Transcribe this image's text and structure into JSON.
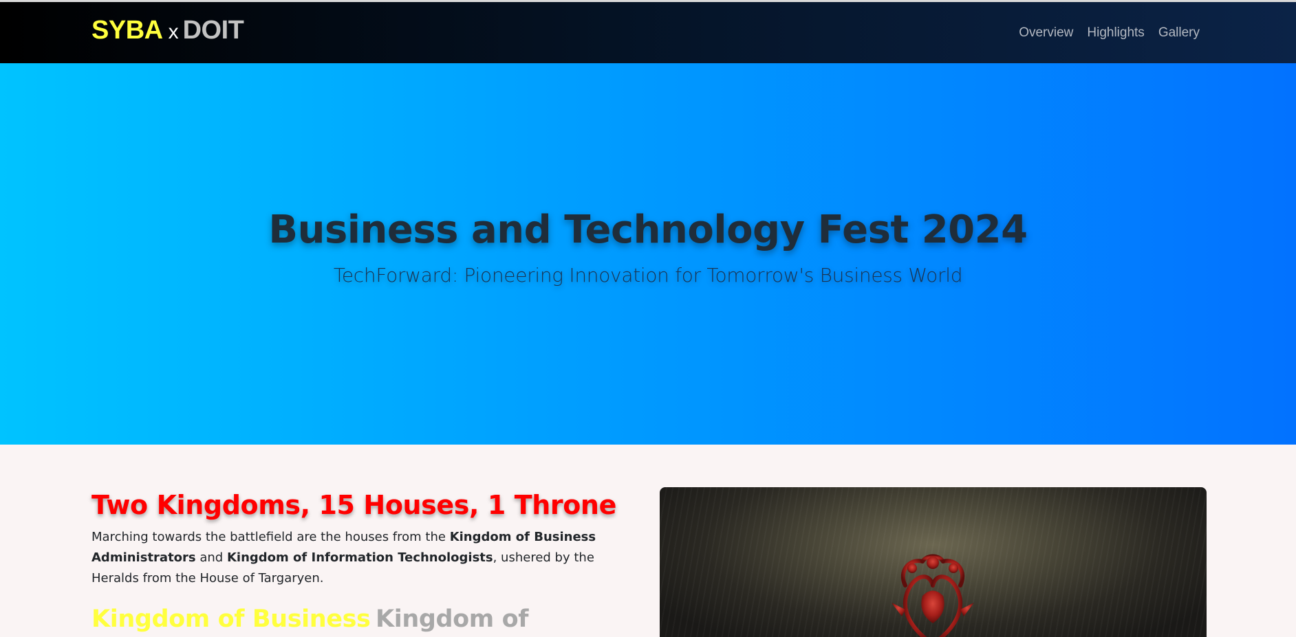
{
  "navbar": {
    "brand_left": "SYBA",
    "brand_x": "x",
    "brand_right": "DOIT",
    "links": [
      "Overview",
      "Highlights",
      "Gallery"
    ]
  },
  "hero": {
    "title": "Business and Technology Fest 2024",
    "subtitle": "TechForward: Pioneering Innovation for Tomorrow's Business World"
  },
  "about": {
    "title": "Two Kingdoms, 15 Houses, 1 Throne",
    "text_1": "Marching towards the battlefield are the houses from the ",
    "bold_1": "Kingdom of Business Administrators",
    "text_2": " and ",
    "bold_2": "Kingdom of Information Technologists",
    "text_3": ", ushered by the Heralds from the House of Targaryen.",
    "kingdom_left": "Kingdom of Business",
    "kingdom_right": "Kingdom of"
  },
  "banner": {
    "icon": "targaryen-dragon-sigil-icon"
  },
  "colors": {
    "brand_yellow": "#ffff3d",
    "brand_gray": "#c2c2c2",
    "hero_start": "#00c3ff",
    "hero_end": "#0272ff",
    "title_red": "#ff0000"
  }
}
